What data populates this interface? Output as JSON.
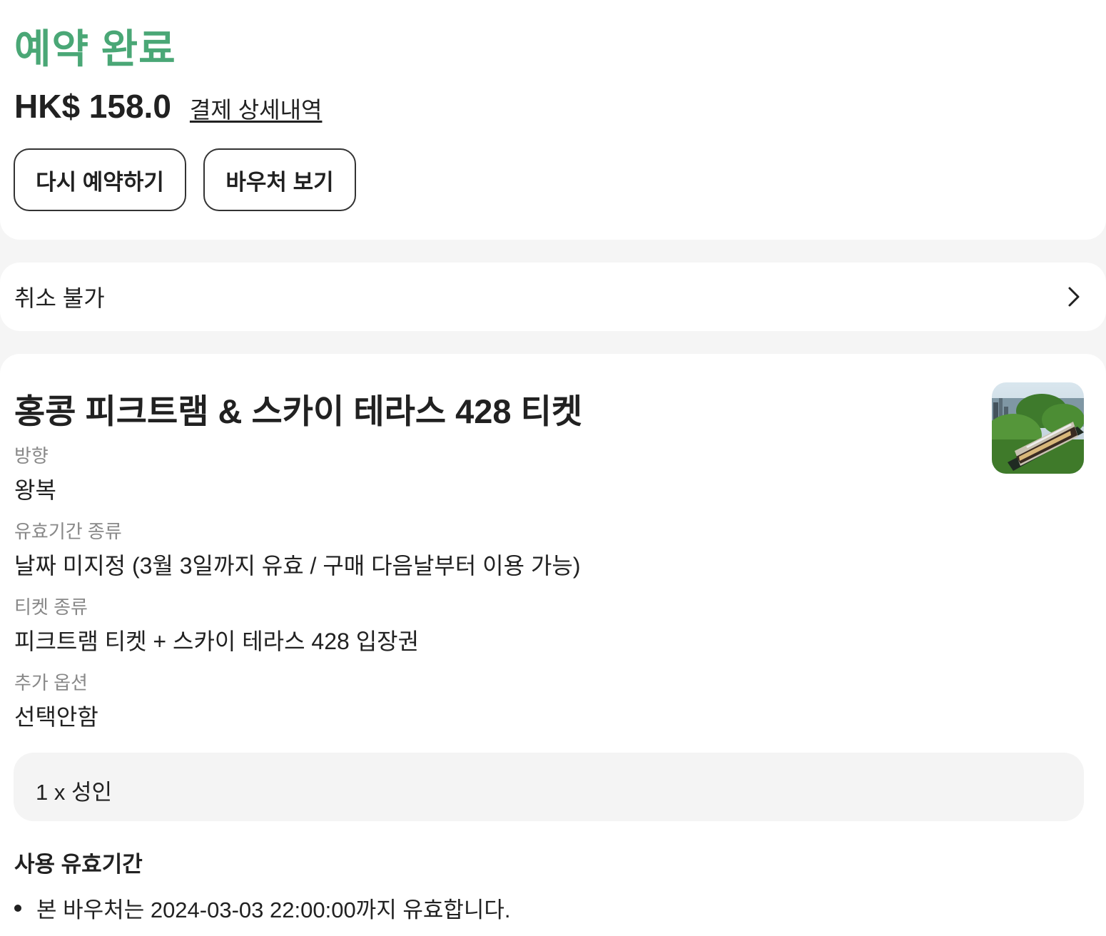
{
  "status": {
    "title": "예약 완료",
    "title_color": "#4aa776",
    "price": "HK$ 158.0",
    "payment_details_link": "결제 상세내역",
    "buttons": {
      "rebook": "다시 예약하기",
      "voucher": "바우처 보기"
    }
  },
  "cancellation": {
    "label": "취소 불가",
    "icon": "chevron-right-icon"
  },
  "product": {
    "title": "홍콩 피크트램 & 스카이 테라스 428 티켓",
    "thumbnail_icon": "peak-tram-photo",
    "fields": [
      {
        "label": "방향",
        "value": "왕복"
      },
      {
        "label": "유효기간 종류",
        "value": "날짜 미지정 (3월 3일까지 유효 / 구매 다음날부터 이용 가능)"
      },
      {
        "label": "티켓 종류",
        "value": "피크트램 티켓 + 스카이 테라스 428 입장권"
      },
      {
        "label": "추가 옵션",
        "value": "선택안함"
      }
    ],
    "quantity": "1 x 성인"
  },
  "validity": {
    "heading": "사용 유효기간",
    "items": [
      "본 바우처는 2024-03-03 22:00:00까지 유효합니다."
    ]
  }
}
